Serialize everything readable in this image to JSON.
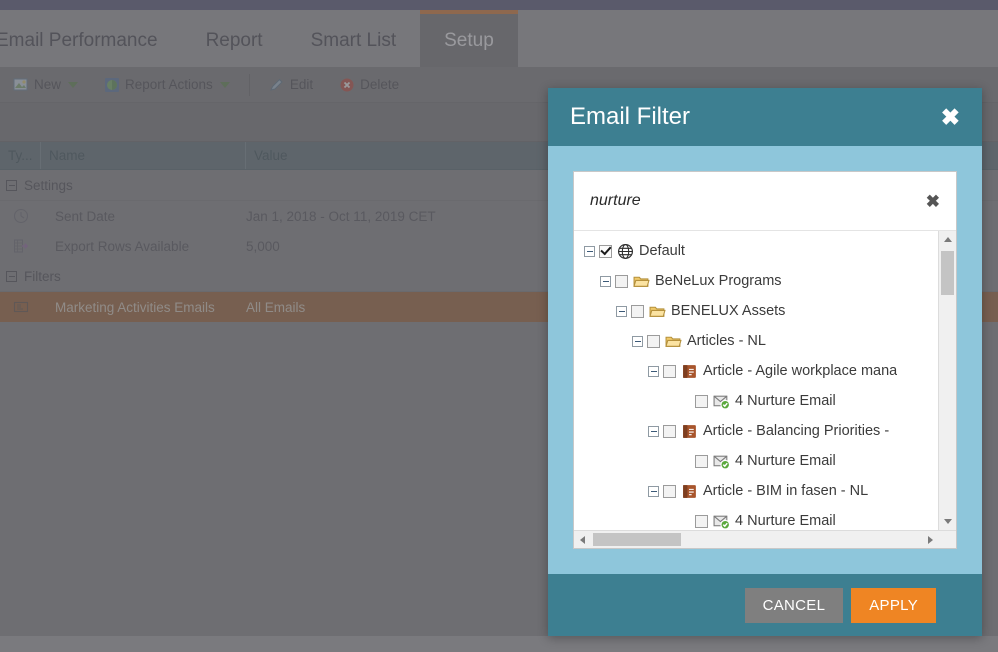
{
  "app": {
    "tabs": [
      {
        "label": "Email Performance",
        "active": false
      },
      {
        "label": "Report",
        "active": false
      },
      {
        "label": "Smart List",
        "active": false
      },
      {
        "label": "Setup",
        "active": true
      }
    ],
    "toolbar": {
      "new_label": "New",
      "report_actions_label": "Report Actions",
      "edit_label": "Edit",
      "delete_label": "Delete"
    },
    "grid": {
      "columns": [
        "Ty...",
        "Name",
        "Value"
      ],
      "groups": [
        {
          "label": "Settings",
          "rows": [
            {
              "icon": "clock-icon",
              "name": "Sent Date",
              "value": "Jan 1, 2018 - Oct 11, 2019 CET",
              "selected": false
            },
            {
              "icon": "export-rows-icon",
              "name": "Export Rows Available",
              "value": "5,000",
              "selected": false
            }
          ]
        },
        {
          "label": "Filters",
          "rows": [
            {
              "icon": "email-filter-icon",
              "name": "Marketing Activities Emails",
              "value": "All Emails",
              "selected": true
            }
          ]
        }
      ]
    }
  },
  "modal": {
    "title": "Email Filter",
    "close_label": "✖",
    "search": {
      "value": "nurture",
      "placeholder": "",
      "clear_label": "✖"
    },
    "tree": [
      {
        "depth": 0,
        "expander": "minus",
        "checked": true,
        "icon": "globe-icon",
        "label": "Default"
      },
      {
        "depth": 1,
        "expander": "minus",
        "checked": false,
        "icon": "folder-icon",
        "label": "BeNeLux Programs"
      },
      {
        "depth": 2,
        "expander": "minus",
        "checked": false,
        "icon": "folder-icon",
        "label": "BENELUX Assets"
      },
      {
        "depth": 3,
        "expander": "minus",
        "checked": false,
        "icon": "folder-icon",
        "label": "Articles - NL"
      },
      {
        "depth": 4,
        "expander": "minus",
        "checked": false,
        "icon": "article-icon",
        "label": "Article - Agile workplace mana"
      },
      {
        "depth": 5,
        "expander": "none",
        "checked": false,
        "icon": "email-check-icon",
        "label": "4 Nurture Email"
      },
      {
        "depth": 4,
        "expander": "minus",
        "checked": false,
        "icon": "article-icon",
        "label": "Article - Balancing Priorities -"
      },
      {
        "depth": 5,
        "expander": "none",
        "checked": false,
        "icon": "email-check-icon",
        "label": "4 Nurture Email"
      },
      {
        "depth": 4,
        "expander": "minus",
        "checked": false,
        "icon": "article-icon",
        "label": "Article - BIM in fasen - NL"
      },
      {
        "depth": 5,
        "expander": "none",
        "checked": false,
        "icon": "email-check-icon",
        "label": "4 Nurture Email"
      }
    ],
    "footer": {
      "cancel_label": "CANCEL",
      "apply_label": "APPLY"
    }
  },
  "colors": {
    "topbar": "#575671",
    "tab_active_accent": "#b5703c",
    "modal_header": "#3d7f91",
    "modal_body": "#8ec6db",
    "apply_button": "#ef8523",
    "cancel_button": "#7f7f7f",
    "selected_row": "#8a6040"
  }
}
